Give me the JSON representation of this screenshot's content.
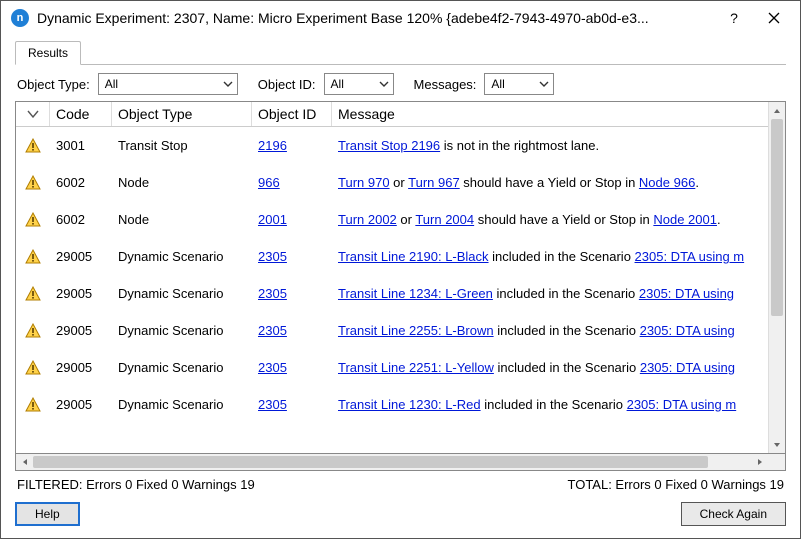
{
  "window": {
    "title": "Dynamic Experiment: 2307, Name: Micro Experiment Base 120%  {adebe4f2-7943-4970-ab0d-e3...",
    "icon_letter": "n"
  },
  "tabs": {
    "results": "Results"
  },
  "filters": {
    "object_type_label": "Object Type:",
    "object_type_value": "All",
    "object_id_label": "Object ID:",
    "object_id_value": "All",
    "messages_label": "Messages:",
    "messages_value": "All"
  },
  "columns": {
    "code": "Code",
    "object_type": "Object Type",
    "object_id": "Object ID",
    "message": "Message"
  },
  "rows": [
    {
      "code": "3001",
      "object_type": "Transit Stop",
      "object_id": "2196",
      "message_parts": [
        {
          "link": true,
          "text": "Transit Stop 2196"
        },
        {
          "link": false,
          "text": " is not in the rightmost lane."
        }
      ]
    },
    {
      "code": "6002",
      "object_type": "Node",
      "object_id": "966",
      "message_parts": [
        {
          "link": true,
          "text": "Turn 970"
        },
        {
          "link": false,
          "text": " or "
        },
        {
          "link": true,
          "text": "Turn 967"
        },
        {
          "link": false,
          "text": " should have a Yield or Stop in "
        },
        {
          "link": true,
          "text": "Node 966"
        },
        {
          "link": false,
          "text": "."
        }
      ]
    },
    {
      "code": "6002",
      "object_type": "Node",
      "object_id": "2001",
      "message_parts": [
        {
          "link": true,
          "text": "Turn 2002"
        },
        {
          "link": false,
          "text": " or "
        },
        {
          "link": true,
          "text": "Turn 2004"
        },
        {
          "link": false,
          "text": " should have a Yield or Stop in "
        },
        {
          "link": true,
          "text": "Node 2001"
        },
        {
          "link": false,
          "text": "."
        }
      ]
    },
    {
      "code": "29005",
      "object_type": "Dynamic Scenario",
      "object_id": "2305",
      "message_parts": [
        {
          "link": true,
          "text": "Transit Line 2190: L-Black"
        },
        {
          "link": false,
          "text": " included in the Scenario "
        },
        {
          "link": true,
          "text": "2305: DTA using m"
        }
      ]
    },
    {
      "code": "29005",
      "object_type": "Dynamic Scenario",
      "object_id": "2305",
      "message_parts": [
        {
          "link": true,
          "text": "Transit Line 1234: L-Green"
        },
        {
          "link": false,
          "text": " included in the Scenario "
        },
        {
          "link": true,
          "text": "2305: DTA using "
        }
      ]
    },
    {
      "code": "29005",
      "object_type": "Dynamic Scenario",
      "object_id": "2305",
      "message_parts": [
        {
          "link": true,
          "text": "Transit Line 2255: L-Brown"
        },
        {
          "link": false,
          "text": " included in the Scenario "
        },
        {
          "link": true,
          "text": "2305: DTA using "
        }
      ]
    },
    {
      "code": "29005",
      "object_type": "Dynamic Scenario",
      "object_id": "2305",
      "message_parts": [
        {
          "link": true,
          "text": "Transit Line 2251: L-Yellow"
        },
        {
          "link": false,
          "text": " included in the Scenario "
        },
        {
          "link": true,
          "text": "2305: DTA using "
        }
      ]
    },
    {
      "code": "29005",
      "object_type": "Dynamic Scenario",
      "object_id": "2305",
      "message_parts": [
        {
          "link": true,
          "text": "Transit Line 1230: L-Red"
        },
        {
          "link": false,
          "text": " included in the Scenario "
        },
        {
          "link": true,
          "text": "2305: DTA using m"
        }
      ]
    }
  ],
  "status": {
    "filtered": "FILTERED:  Errors 0  Fixed 0  Warnings 19",
    "total": "TOTAL:  Errors 0  Fixed 0  Warnings 19"
  },
  "buttons": {
    "help": "Help",
    "check_again": "Check Again"
  }
}
